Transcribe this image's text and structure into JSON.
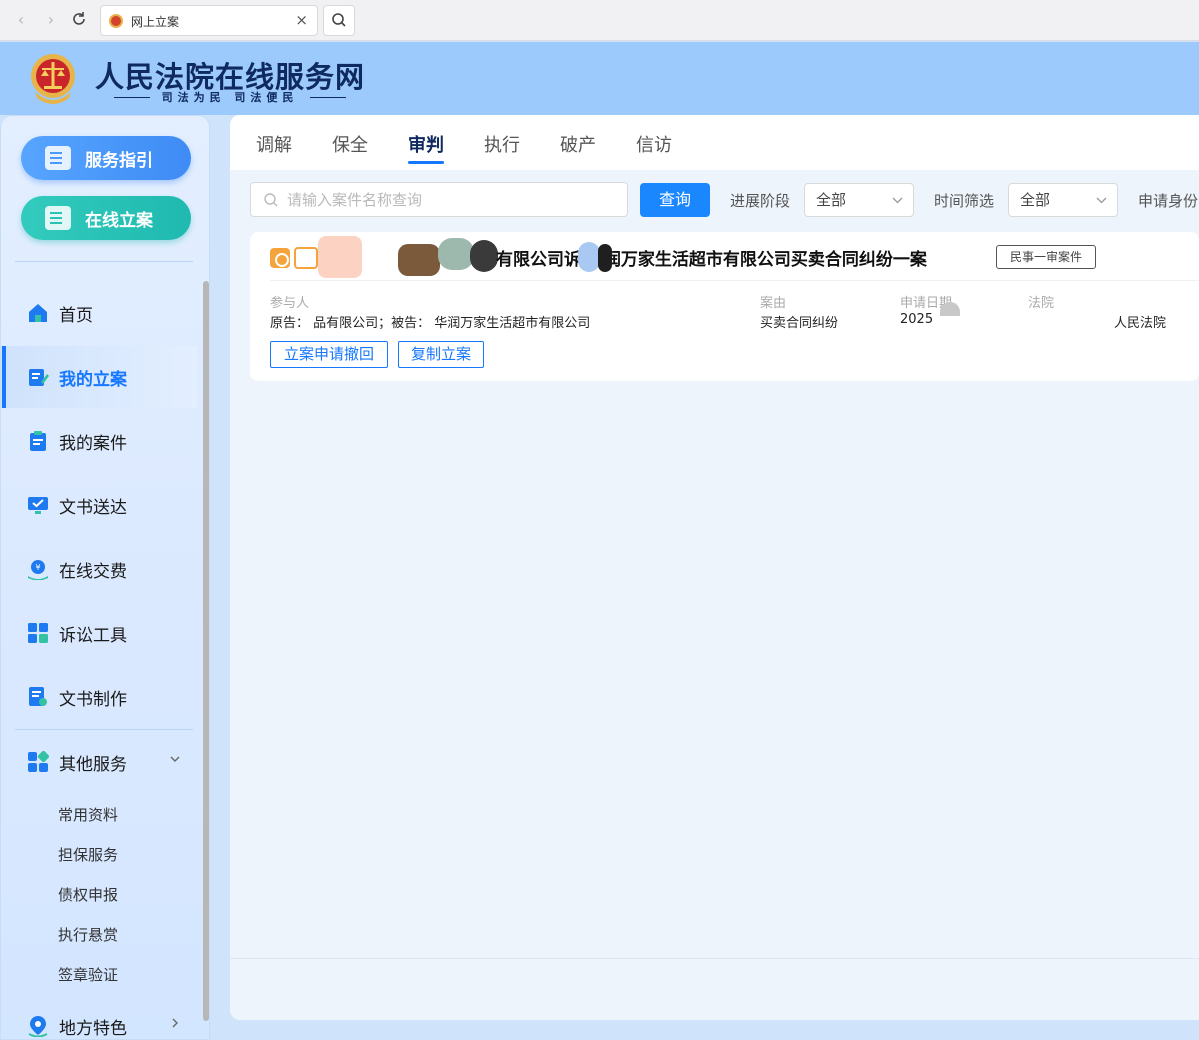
{
  "browser": {
    "tab_title": "网上立案",
    "close_glyph": "×"
  },
  "header": {
    "site_title": "人民法院在线服务网",
    "slogan": "司法为民  司法便民"
  },
  "sidebar": {
    "service_guide": "服务指引",
    "online_filing": "在线立案",
    "items": [
      {
        "label": "首页",
        "icon": "home-icon"
      },
      {
        "label": "我的立案",
        "icon": "edit-icon"
      },
      {
        "label": "我的案件",
        "icon": "clipboard-icon"
      },
      {
        "label": "文书送达",
        "icon": "monitor-check-icon"
      },
      {
        "label": "在线交费",
        "icon": "payment-icon"
      },
      {
        "label": "诉讼工具",
        "icon": "calculator-icon"
      },
      {
        "label": "文书制作",
        "icon": "document-search-icon"
      }
    ],
    "other_services": "其他服务",
    "sub_items": [
      "常用资料",
      "担保服务",
      "债权申报",
      "执行悬赏",
      "签章验证"
    ],
    "local_features": "地方特色"
  },
  "tabs": [
    "调解",
    "保全",
    "审判",
    "执行",
    "破产",
    "信访"
  ],
  "filters": {
    "search_placeholder": "请输入案件名称查询",
    "query_button": "查询",
    "stage_label": "进展阶段",
    "stage_value": "全部",
    "time_label": "时间筛选",
    "time_value": "全部",
    "identity_label": "申请身份"
  },
  "case": {
    "title": "有限公司诉  华润万家生活超市有限公司买卖合同纠纷一案",
    "badge": "民事一审案件",
    "participants_label": "参与人",
    "participants_value": "原告：              品有限公司；被告：          华润万家生活超市有限公司",
    "cause_label": "案由",
    "cause_value": "买卖合同纠纷",
    "date_label": "申请日期",
    "date_value": "2025",
    "court_label": "法院",
    "court_value": "人民法院",
    "withdraw_button": "立案申请撤回",
    "copy_button": "复制立案"
  },
  "colors": {
    "accent": "#1677ff",
    "header_bg": "#9ccafc",
    "title_navy": "#0f2a5f"
  }
}
